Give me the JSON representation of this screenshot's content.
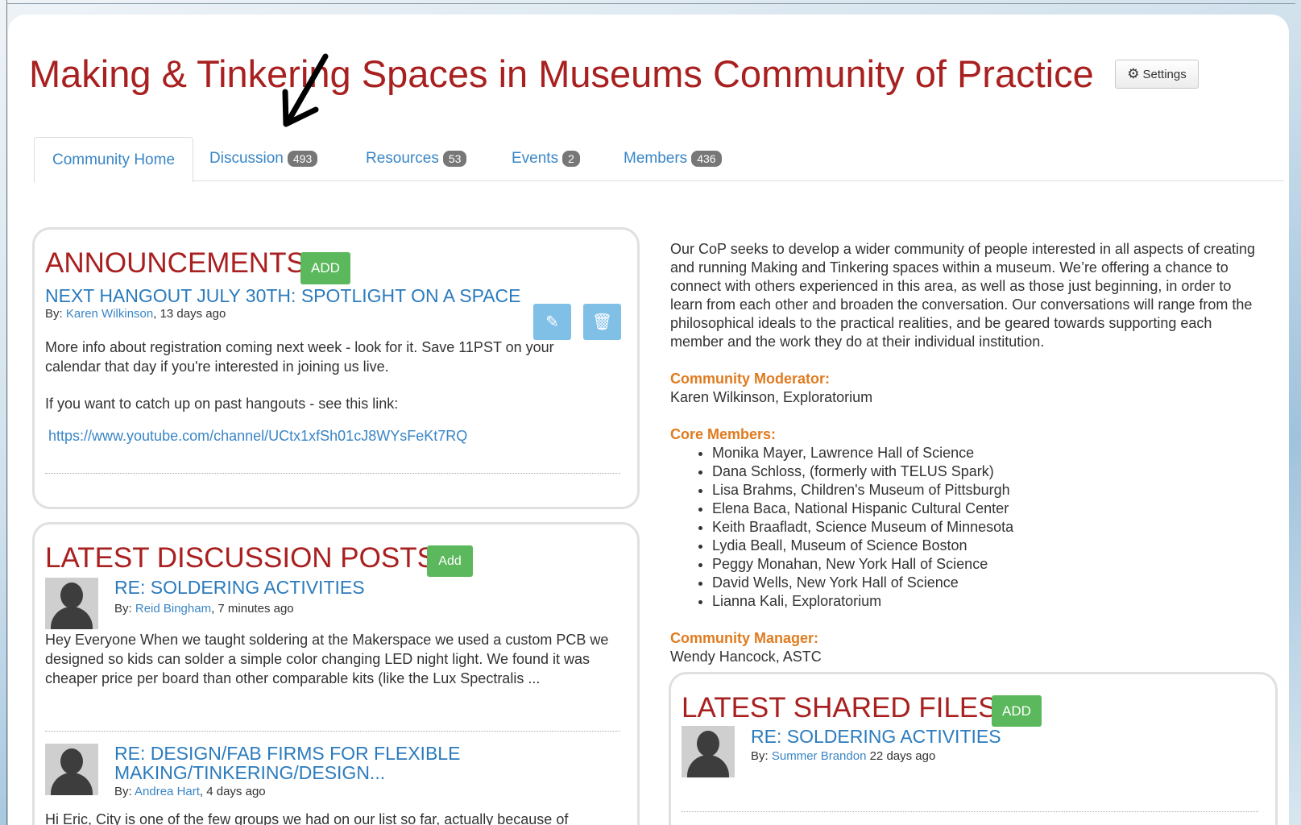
{
  "page": {
    "title": "Making & Tinkering Spaces in Museums Community of Practice",
    "settings_label": "Settings",
    "colors": {
      "title": "#a8201f",
      "link": "#3a86c6",
      "add_button": "#5cb85c",
      "label": "#e07b1f"
    }
  },
  "tabs": [
    {
      "label": "Community Home"
    },
    {
      "label": "Discussion",
      "count": "493"
    },
    {
      "label": "Resources",
      "count": "53"
    },
    {
      "label": "Events",
      "count": "2"
    },
    {
      "label": "Members",
      "count": "436"
    }
  ],
  "announcements": {
    "heading": "ANNOUNCEMENTS",
    "add_label": "ADD",
    "item": {
      "title": "NEXT HANGOUT JULY 30TH: SPOTLIGHT ON A SPACE",
      "by": "By:",
      "author": "Karen Wilkinson",
      "time": ", 13 days ago",
      "para1": "More info about registration coming next week - look for it. Save 11PST on your calendar that day if you're interested in joining us live.",
      "para2": "If you want to catch up on past hangouts - see this link:",
      "link": "https://www.youtube.com/channel/UCtx1xfSh01cJ8WYsFeKt7RQ"
    }
  },
  "discussion": {
    "heading": "LATEST DISCUSSION POSTS",
    "add_label": "Add",
    "posts": [
      {
        "title": "RE: SOLDERING ACTIVITIES",
        "by": "By:",
        "author": "Reid Bingham",
        "time": ", 7 minutes ago",
        "excerpt": "Hey Everyone When we taught soldering at the Makerspace we used a custom PCB we designed so kids can solder a simple color changing LED night light. We found it was cheaper price per board than other comparable kits (like the Lux Spectralis ..."
      },
      {
        "title_line1": "RE: DESIGN/FAB FIRMS FOR FLEXIBLE",
        "title_line2": "MAKING/TINKERING/DESIGN...",
        "by": "By:",
        "author": "Andrea Hart",
        "time": ", 4 days ago",
        "excerpt": "Hi Eric, City is one of the few groups we had on our list so far, actually because of"
      }
    ]
  },
  "about": {
    "description": "Our CoP seeks to develop a wider community of people interested in all aspects of creating and running Making and Tinkering spaces within a museum. We’re offering a chance to connect with others experienced in this area, as well as those just beginning, in order to learn from each other and broaden the conversation. Our conversations will range from the philosophical ideals to the practical realities, and be geared towards supporting each member and the work they do at their individual institution.",
    "moderator_label": "Community Moderator:",
    "moderator": "Karen Wilkinson, Exploratorium",
    "core_label": "Core Members:",
    "core_members": [
      "Monika Mayer, Lawrence Hall of Science",
      "Dana Schloss, (formerly with TELUS Spark)",
      "Lisa Brahms, Children's Museum of Pittsburgh",
      "Elena Baca, National Hispanic Cultural Center",
      "Keith Braafladt, Science Museum of Minnesota",
      "Lydia Beall, Museum of Science Boston",
      "Peggy Monahan, New York Hall of Science",
      "David Wells, New York Hall of Science",
      "Lianna Kali, Exploratorium"
    ],
    "manager_label": "Community Manager:",
    "manager": "Wendy Hancock, ASTC"
  },
  "files": {
    "heading": "LATEST SHARED FILES",
    "add_label": "ADD",
    "item": {
      "title": "RE: SOLDERING ACTIVITIES",
      "by": "By:",
      "author": "Summer Brandon",
      "time": " 22 days ago"
    }
  }
}
